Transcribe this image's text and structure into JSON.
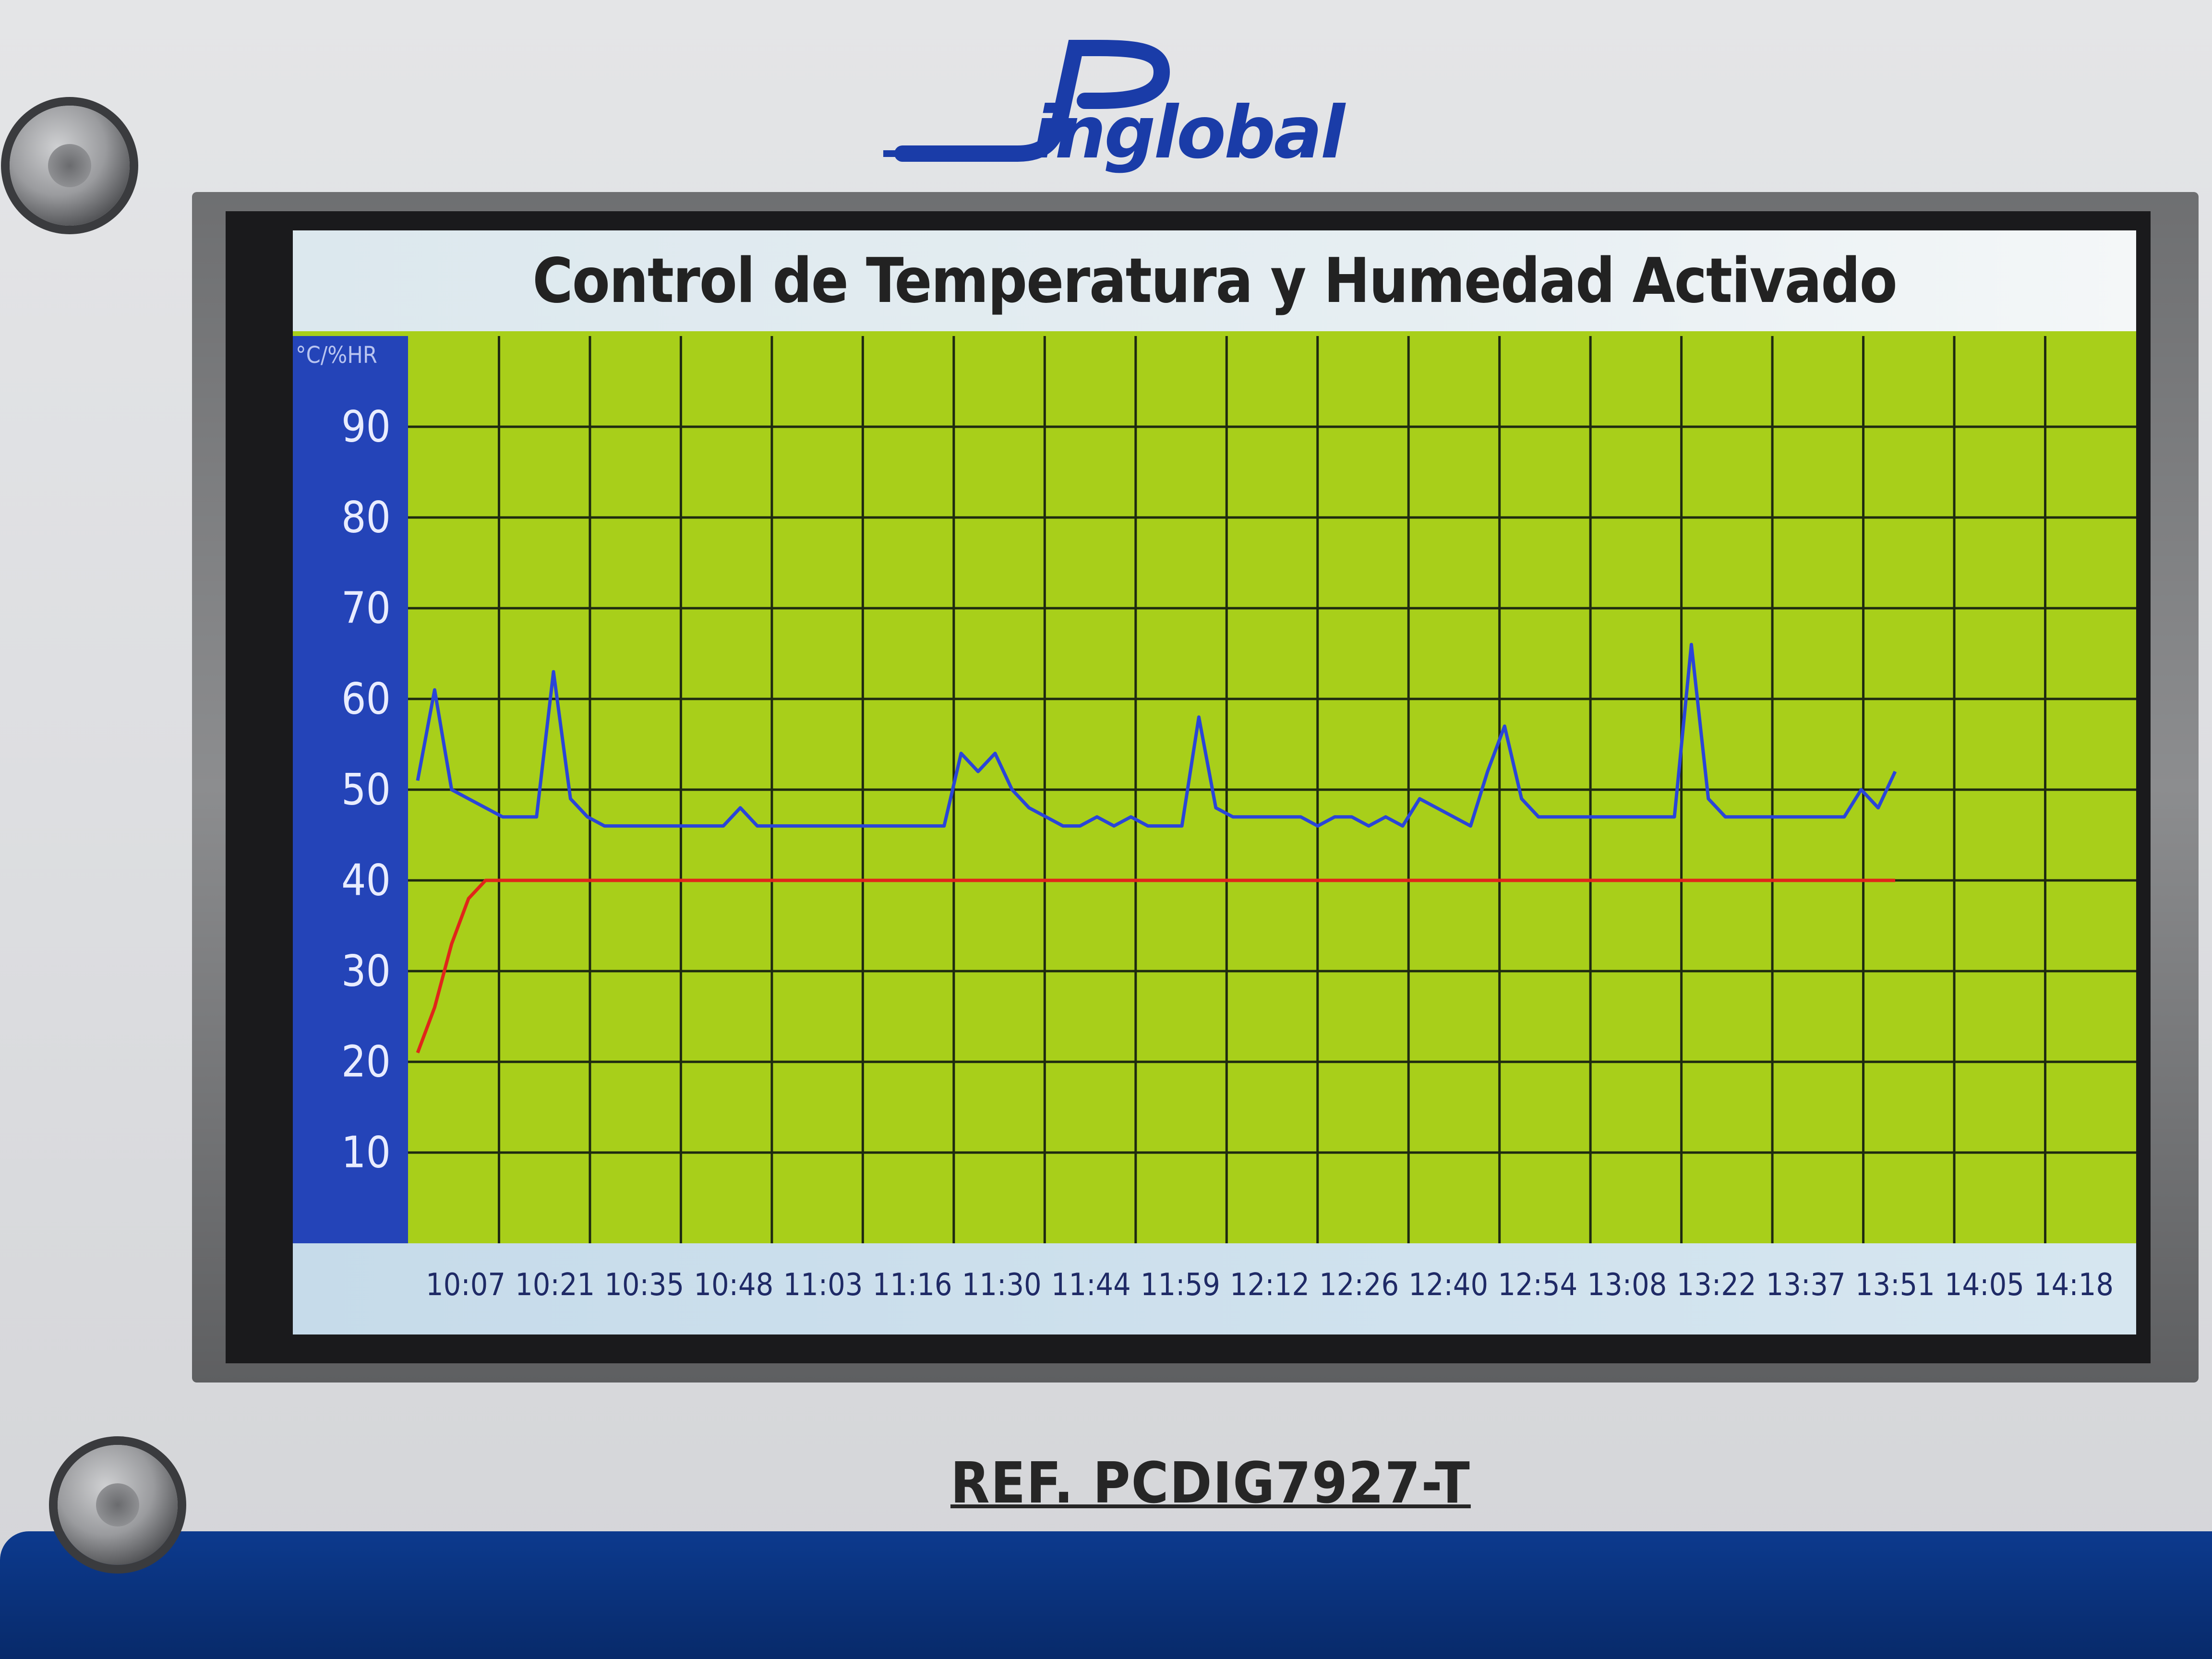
{
  "brand": {
    "logo_text": "inglobal"
  },
  "screen": {
    "title": "Control de Temperatura y Humedad Activado",
    "y_unit_label": "°C/%HR"
  },
  "device": {
    "reference": "REF. PCDIG7927-T"
  },
  "colors": {
    "plot_background": "#a8cf1a",
    "grid": "#1e2a10",
    "humidity_line": "#2a45d8",
    "temperature_line": "#e0261a",
    "axis_band": "#2444b8",
    "brand_blue": "#1a3ca8"
  },
  "chart_data": {
    "type": "line",
    "title": "Control de Temperatura y Humedad Activado",
    "ylabel": "°C/%HR",
    "xlabel": "",
    "ylim": [
      0,
      100
    ],
    "yticks": [
      10,
      20,
      30,
      40,
      50,
      60,
      70,
      80,
      90
    ],
    "categories": [
      "10:07",
      "10:21",
      "10:35",
      "10:48",
      "11:03",
      "11:16",
      "11:30",
      "11:44",
      "11:59",
      "12:12",
      "12:26",
      "12:40",
      "12:54",
      "13:08",
      "13:22",
      "13:37",
      "13:51",
      "14:05",
      "14:18"
    ],
    "grid": true,
    "series": [
      {
        "values": [
          51,
          61,
          50,
          49,
          48,
          47,
          47,
          47,
          63,
          49,
          47,
          46,
          46,
          46,
          46,
          46,
          46,
          46,
          46,
          48,
          46,
          46,
          46,
          46,
          46,
          46,
          46,
          46,
          46,
          46,
          46,
          46,
          54,
          52,
          54,
          50,
          48,
          47,
          46,
          46,
          47,
          46,
          47,
          46,
          46,
          46,
          58,
          48,
          47,
          47,
          47,
          47,
          47,
          46,
          47,
          47,
          46,
          47,
          46,
          49,
          48,
          47,
          46,
          52,
          57,
          49,
          47,
          47,
          47,
          47,
          47,
          47,
          47,
          47,
          47,
          66,
          49,
          47,
          47,
          47,
          47,
          47,
          47,
          47,
          47,
          50,
          48,
          52
        ]
      },
      {
        "values": [
          21,
          26,
          33,
          38,
          40,
          40,
          40,
          40,
          40,
          40,
          40,
          40,
          40,
          40,
          40,
          40,
          40,
          40,
          40,
          40,
          40,
          40,
          40,
          40,
          40,
          40,
          40,
          40,
          40,
          40,
          40,
          40,
          40,
          40,
          40,
          40,
          40,
          40,
          40,
          40,
          40,
          40,
          40,
          40,
          40,
          40,
          40,
          40,
          40,
          40,
          40,
          40,
          40,
          40,
          40,
          40,
          40,
          40,
          40,
          40,
          40,
          40,
          40,
          40,
          40,
          40,
          40,
          40,
          40,
          40,
          40,
          40,
          40,
          40,
          40,
          40,
          40,
          40,
          40,
          40,
          40,
          40,
          40,
          40,
          40,
          40,
          40,
          40
        ]
      }
    ]
  }
}
